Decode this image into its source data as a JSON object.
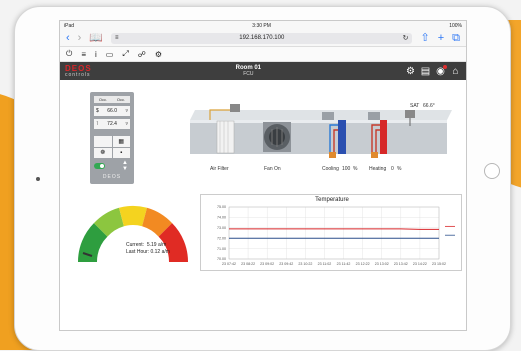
{
  "ios": {
    "carrier": "iPad",
    "wifi": "wifi",
    "time": "3:30 PM",
    "battery": "100%"
  },
  "browser": {
    "url": "192.168.170.100",
    "icons": [
      "back-icon",
      "forward-icon",
      "bookmarks-icon",
      "reader-icon",
      "reload-icon",
      "share-icon",
      "new-tab-icon",
      "tabs-icon"
    ]
  },
  "app_toolbar": {
    "icons": [
      "power-icon",
      "menu-icon",
      "info-icon",
      "monitor-icon",
      "expand-icon",
      "link-icon",
      "gear-icon"
    ]
  },
  "header": {
    "logo_top": "DEOS",
    "logo_bottom": "controls",
    "room_title": "Room 01",
    "room_subtitle": "FCU",
    "icons": [
      "settings-icon",
      "stats-icon",
      "alarm-icon",
      "home-icon"
    ]
  },
  "thermostat": {
    "top_left": "Occ.",
    "top_right": "Occ.",
    "setpoint": "66.0",
    "temp": "72.4",
    "brand": "DEOS"
  },
  "ahu": {
    "sat_label": "SAT",
    "sat_value": "66.6°",
    "air_filter_label": "Air Filter",
    "fan_label": "Fan On",
    "cooling_label": "Cooling",
    "cooling_value": "100",
    "cooling_unit": "%",
    "heating_label": "Heating",
    "heating_value": "0",
    "heating_unit": "%"
  },
  "gauge": {
    "current_label": "Current:",
    "current_value": "5.19 a/m",
    "last_hour_label": "Last Hour:",
    "last_hour_value": "0.12 a/m"
  },
  "chart_data": {
    "type": "line",
    "title": "Temperature",
    "x_ticks": [
      "23 07:42",
      "23 08:22",
      "23 09:02",
      "23 09:42",
      "23 10:22",
      "23 11:02",
      "23 11:42",
      "23 12:22",
      "23 13:02",
      "23 13:42",
      "23 14:22",
      "23 15:02"
    ],
    "y_ticks": [
      "70.00",
      "71.00",
      "72.00",
      "73.00",
      "74.00",
      "75.00"
    ],
    "ylim": [
      70,
      75
    ],
    "series": [
      {
        "name": "",
        "color": "#d9262a",
        "values": [
          72.9,
          72.9,
          72.9,
          72.9,
          72.9,
          72.9,
          72.9,
          72.9,
          72.9,
          72.9,
          72.85,
          72.85
        ]
      },
      {
        "name": "",
        "color": "#2c4f8c",
        "values": [
          72.0,
          72.0,
          72.0,
          72.0,
          72.0,
          72.0,
          72.0,
          72.0,
          72.0,
          72.0,
          72.0,
          72.0
        ]
      }
    ]
  }
}
